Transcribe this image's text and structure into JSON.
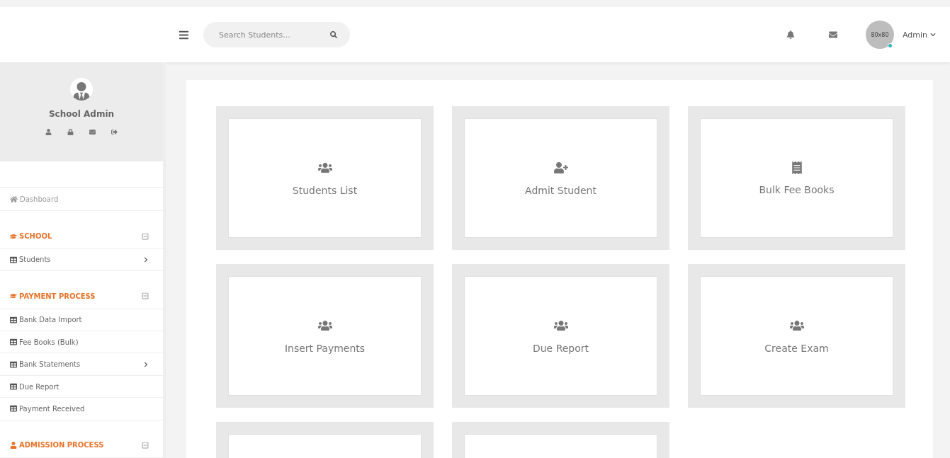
{
  "topbar": {
    "search": {
      "placeholder": "Search Students..."
    },
    "avatar_text": "80x80",
    "user": "Admin",
    "online": true
  },
  "profile": {
    "name": "School Admin"
  },
  "sidebar": {
    "dashboard": "Dashboard",
    "sections": [
      {
        "title": "SCHOOL",
        "kind": "academic",
        "expanded": true,
        "items": [
          {
            "label": "Students",
            "has_submenu": true
          }
        ]
      },
      {
        "title": "PAYMENT PROCESS",
        "kind": "academic",
        "expanded": true,
        "items": [
          {
            "label": "Bank Data Import",
            "has_submenu": false
          },
          {
            "label": "Fee Books (Bulk)",
            "has_submenu": false
          },
          {
            "label": "Bank Statements",
            "has_submenu": true
          },
          {
            "label": "Due Report",
            "has_submenu": false
          },
          {
            "label": "Payment Received",
            "has_submenu": false
          }
        ]
      },
      {
        "title": "ADMISSION PROCESS",
        "kind": "people",
        "expanded": true
      }
    ]
  },
  "cards": [
    {
      "kind": "users",
      "label": "Students List"
    },
    {
      "kind": "user-plus",
      "label": "Admit Student"
    },
    {
      "kind": "receipt",
      "label": "Bulk Fee Books"
    },
    {
      "kind": "users",
      "label": "Insert Payments"
    },
    {
      "kind": "users",
      "label": "Due Report"
    },
    {
      "kind": "users",
      "label": "Create Exam"
    },
    {
      "kind": "blank"
    },
    {
      "kind": "blank"
    }
  ]
}
